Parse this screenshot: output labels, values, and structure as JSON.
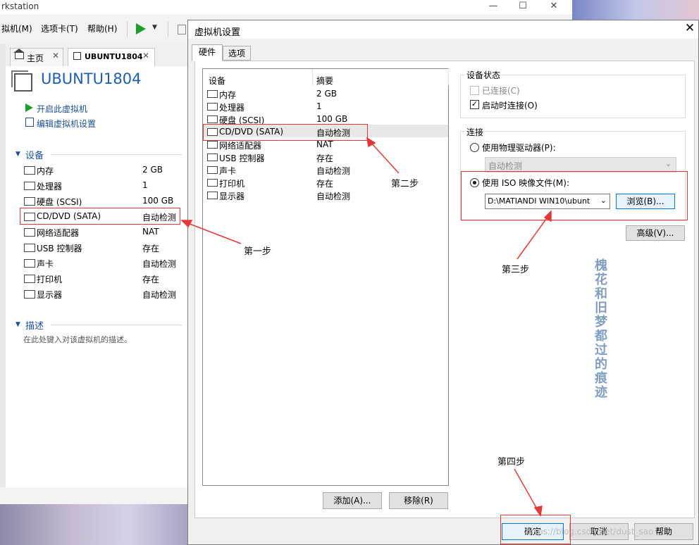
{
  "bg_window": {
    "title": "rkstation",
    "menu": [
      "拟机(M)",
      "选项卡(T)",
      "帮助(H)"
    ],
    "tabs": [
      {
        "label": "主页"
      },
      {
        "label": "UBUNTU1804"
      }
    ],
    "vm_name": "UBUNTU1804",
    "actions": [
      "开启此虚拟机",
      "编辑虚拟机设置"
    ],
    "devices_heading": "设备",
    "devices": [
      {
        "name": "内存",
        "value": "2 GB"
      },
      {
        "name": "处理器",
        "value": "1"
      },
      {
        "name": "硬盘 (SCSI)",
        "value": "100 GB"
      },
      {
        "name": "CD/DVD (SATA)",
        "value": "自动检测"
      },
      {
        "name": "网络适配器",
        "value": "NAT"
      },
      {
        "name": "USB 控制器",
        "value": "存在"
      },
      {
        "name": "声卡",
        "value": "自动检测"
      },
      {
        "name": "打印机",
        "value": "存在"
      },
      {
        "name": "显示器",
        "value": "自动检测"
      }
    ],
    "desc_heading": "描述",
    "desc_placeholder": "在此处键入对该虚拟机的描述。"
  },
  "dialog": {
    "title": "虚拟机设置",
    "tabs": [
      "硬件",
      "选项"
    ],
    "list_headers": {
      "device": "设备",
      "summary": "摘要"
    },
    "devices": [
      {
        "name": "内存",
        "value": "2 GB"
      },
      {
        "name": "处理器",
        "value": "1"
      },
      {
        "name": "硬盘 (SCSI)",
        "value": "100 GB"
      },
      {
        "name": "CD/DVD (SATA)",
        "value": "自动检测"
      },
      {
        "name": "网络适配器",
        "value": "NAT"
      },
      {
        "name": "USB 控制器",
        "value": "存在"
      },
      {
        "name": "声卡",
        "value": "自动检测"
      },
      {
        "name": "打印机",
        "value": "存在"
      },
      {
        "name": "显示器",
        "value": "自动检测"
      }
    ],
    "selected_device": "CD/DVD (SATA)",
    "add_button": "添加(A)...",
    "remove_button": "移除(R)",
    "device_status": {
      "title": "设备状态",
      "connected_label": "已连接(C)",
      "connected_checked": false,
      "connect_on_start_label": "启动时连接(O)",
      "connect_on_start_checked": true
    },
    "connection": {
      "title": "连接",
      "physical_label": "使用物理驱动器(P):",
      "physical_value": "自动检测",
      "iso_label": "使用 ISO 映像文件(M):",
      "iso_value": "D:\\MATIANDI WIN10\\ubunt",
      "browse_button": "浏览(B)...",
      "selected": "iso"
    },
    "advanced_button": "高级(V)...",
    "ok_button": "确定",
    "cancel_button": "取消",
    "help_button": "帮助"
  },
  "annotations": {
    "step1": "第一步",
    "step2": "第二步",
    "step3": "第三步",
    "step4": "第四步",
    "highlight_color": "#e53935"
  },
  "watermark": {
    "vertical_text": "槐花和旧梦都过的痕迹",
    "csdn_text": "https://blog.csdn.net/dust_sao"
  },
  "icons": {
    "play": "play-icon",
    "home": "home-icon",
    "close": "close-icon"
  }
}
